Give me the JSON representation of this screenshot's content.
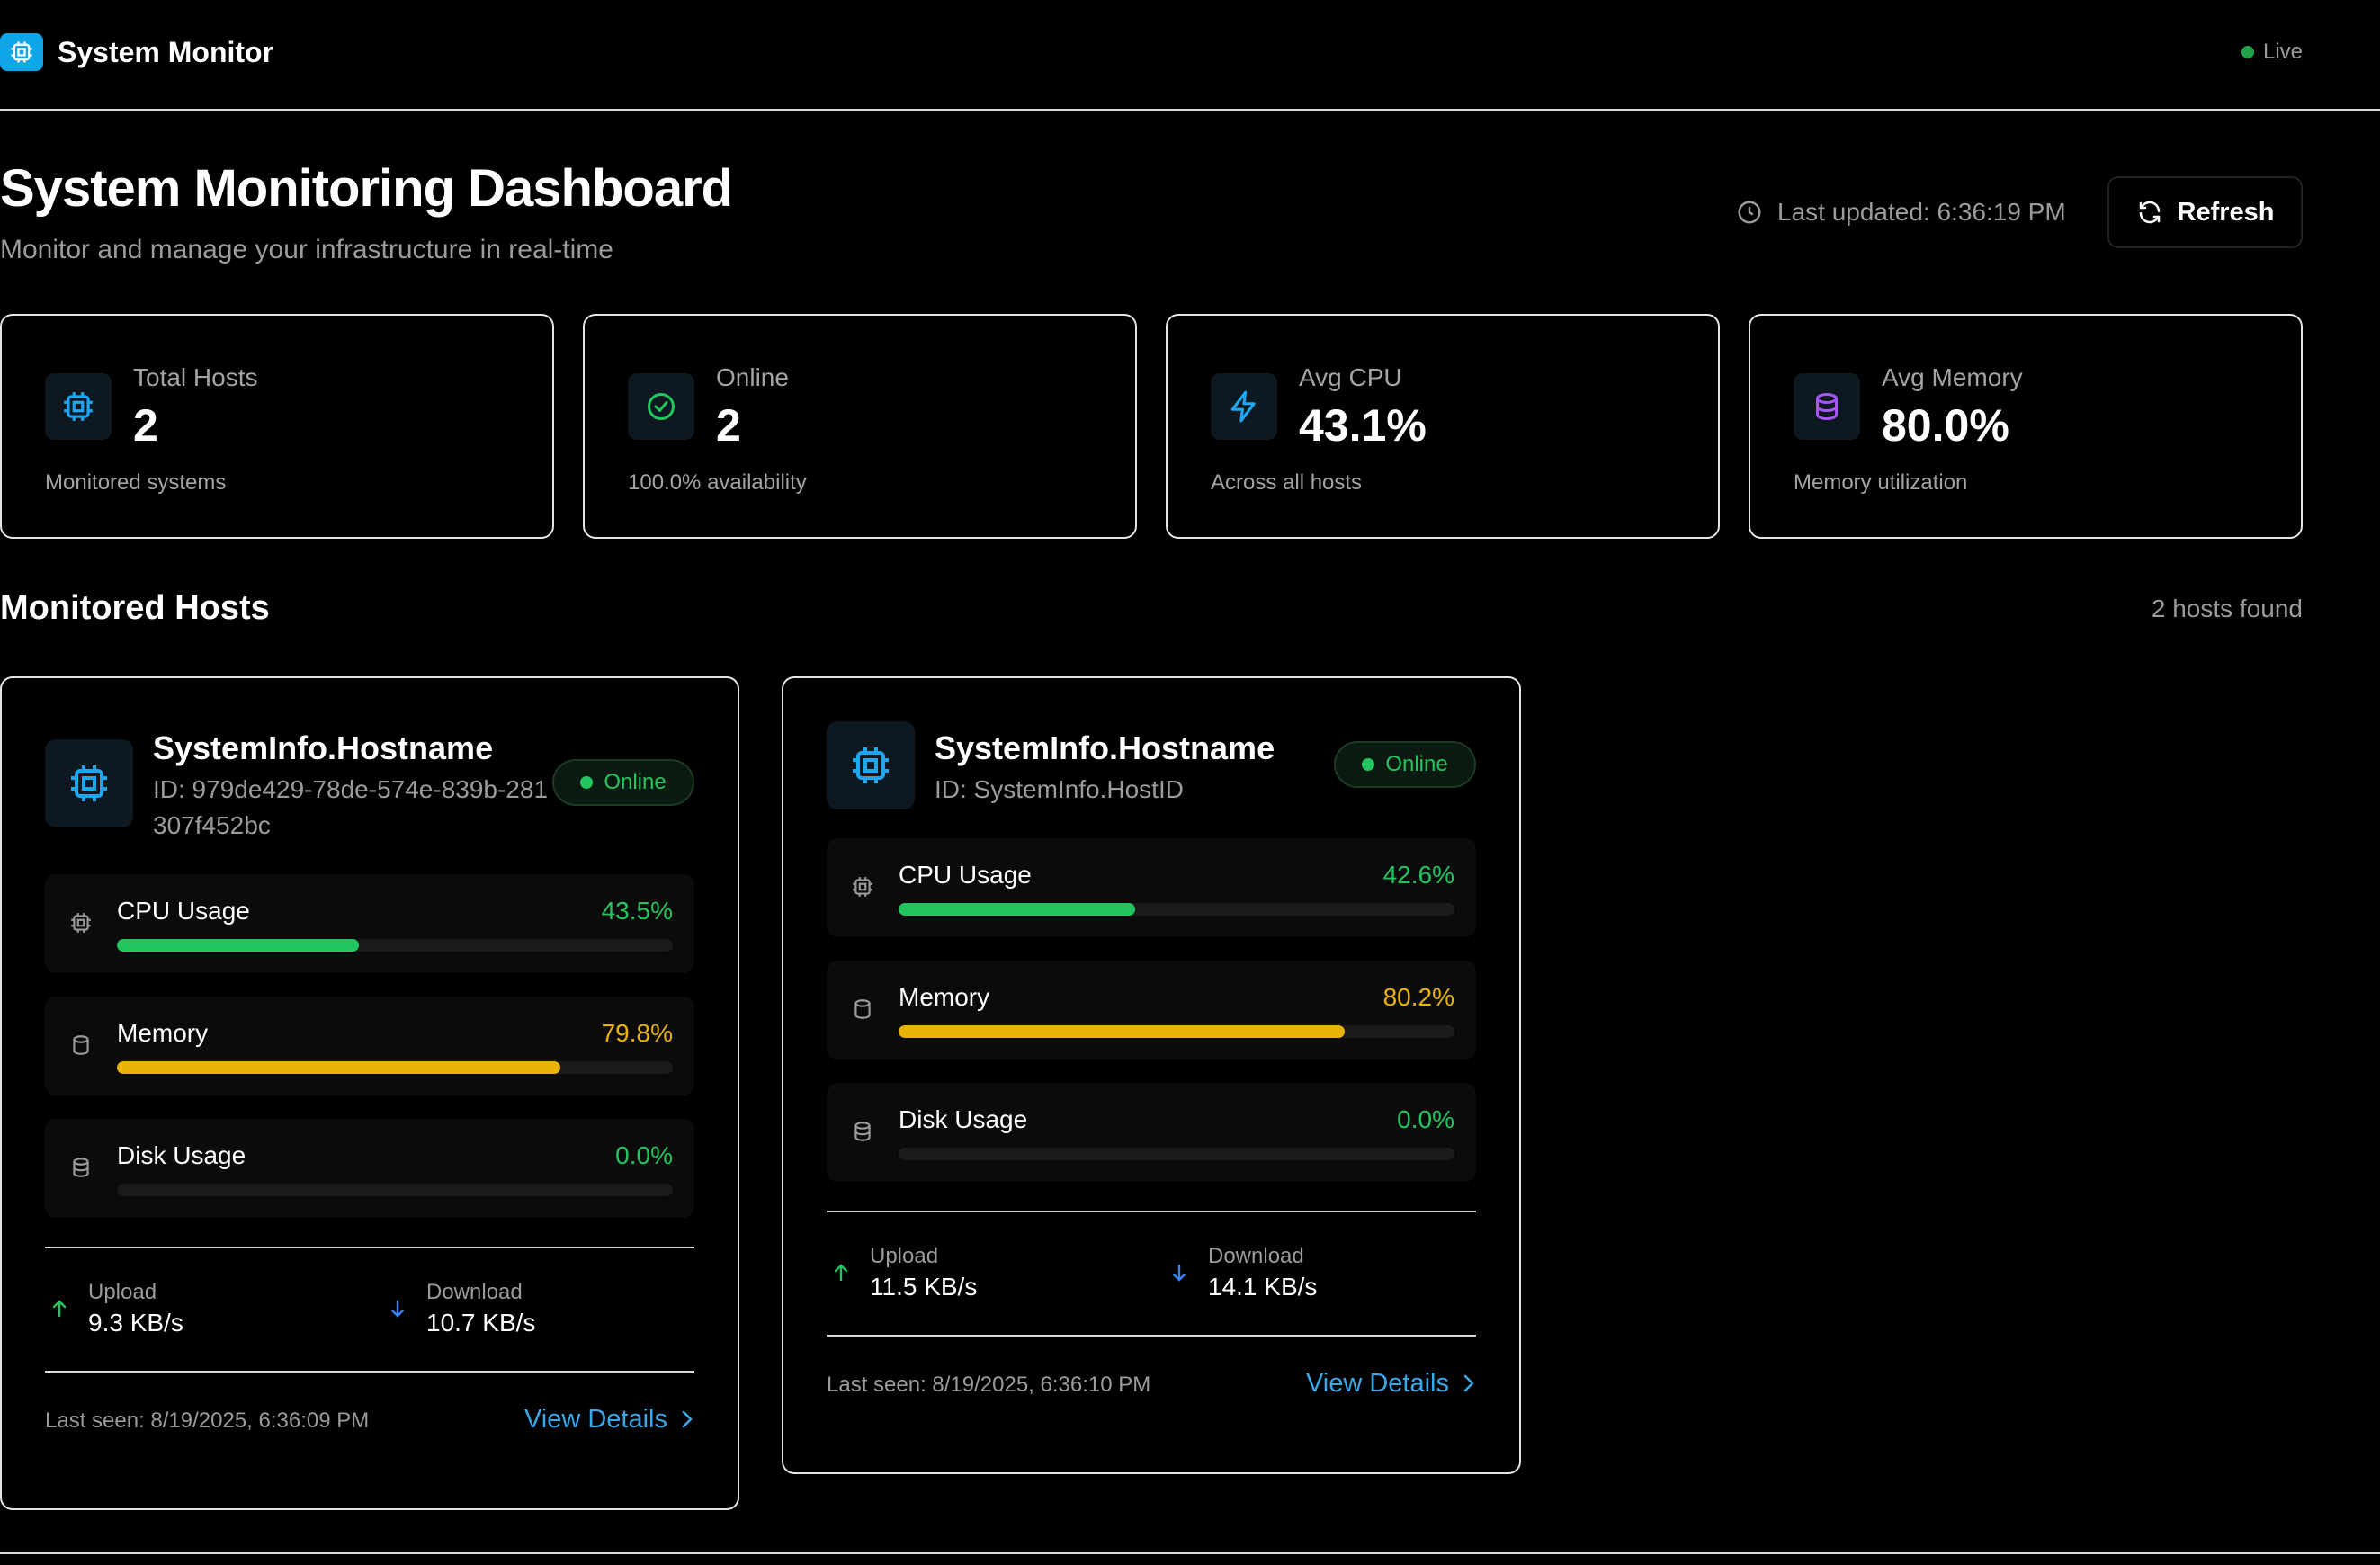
{
  "app": {
    "title": "System Monitor",
    "live_label": "Live"
  },
  "header": {
    "title": "System Monitoring Dashboard",
    "subtitle": "Monitor and manage your infrastructure in real-time",
    "last_updated": "Last updated: 6:36:19 PM",
    "refresh_label": "Refresh"
  },
  "stats": [
    {
      "label": "Total Hosts",
      "value": "2",
      "sub": "Monitored systems",
      "icon": "cpu-icon",
      "color": "#1ea7f0"
    },
    {
      "label": "Online",
      "value": "2",
      "sub": "100.0% availability",
      "icon": "check-circle-icon",
      "color": "#22c55e"
    },
    {
      "label": "Avg CPU",
      "value": "43.1%",
      "sub": "Across all hosts",
      "icon": "lightning-icon",
      "color": "#1ea7f0"
    },
    {
      "label": "Avg Memory",
      "value": "80.0%",
      "sub": "Memory utilization",
      "icon": "database-icon",
      "color": "#a855f7"
    }
  ],
  "hosts_section": {
    "title": "Monitored Hosts",
    "count_label": "2 hosts found"
  },
  "hosts": [
    {
      "name": "SystemInfo.Hostname",
      "id": "ID: 979de429-78de-574e-839b-281307f452bc",
      "status": "Online",
      "metrics": [
        {
          "label": "CPU Usage",
          "value": "43.5%",
          "fraction": 0.435,
          "color": "#22c55e"
        },
        {
          "label": "Memory",
          "value": "79.8%",
          "fraction": 0.798,
          "color": "#eab308"
        },
        {
          "label": "Disk Usage",
          "value": "0.0%",
          "fraction": 0.0,
          "color": "#22c55e"
        }
      ],
      "upload_label": "Upload",
      "upload": "9.3 KB/s",
      "download_label": "Download",
      "download": "10.7 KB/s",
      "last_seen": "Last seen: 8/19/2025, 6:36:09 PM",
      "details_label": "View Details"
    },
    {
      "name": "SystemInfo.Hostname",
      "id": "ID: SystemInfo.HostID",
      "status": "Online",
      "metrics": [
        {
          "label": "CPU Usage",
          "value": "42.6%",
          "fraction": 0.426,
          "color": "#22c55e"
        },
        {
          "label": "Memory",
          "value": "80.2%",
          "fraction": 0.802,
          "color": "#eab308"
        },
        {
          "label": "Disk Usage",
          "value": "0.0%",
          "fraction": 0.0,
          "color": "#22c55e"
        }
      ],
      "upload_label": "Upload",
      "upload": "11.5 KB/s",
      "download_label": "Download",
      "download": "14.1 KB/s",
      "last_seen": "Last seen: 8/19/2025, 6:36:10 PM",
      "details_label": "View Details"
    }
  ]
}
